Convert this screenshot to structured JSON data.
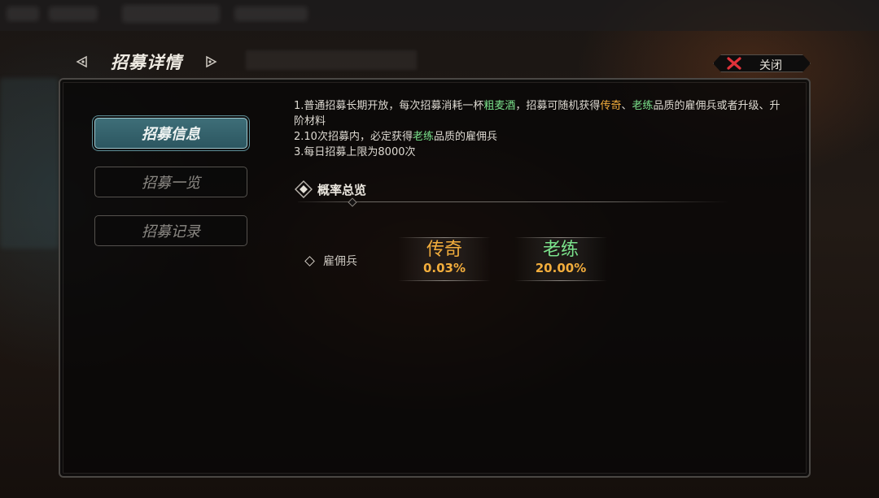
{
  "header": {
    "title": "招募详情",
    "close_label": "关闭"
  },
  "tabs": [
    {
      "label": "招募信息",
      "active": true
    },
    {
      "label": "招募一览",
      "active": false
    },
    {
      "label": "招募记录",
      "active": false
    }
  ],
  "description": {
    "line1_a": "1.普通招募长期开放，每次招募消耗一杯",
    "line1_item": "粗麦酒",
    "line1_b": "，招募可随机获得",
    "line1_rarity1": "传奇",
    "line1_sep": "、",
    "line1_rarity2": "老练",
    "line1_c": "品质的雇佣兵或者升级、升阶材料",
    "line2_a": "2.10次招募内，必定获得",
    "line2_rarity": "老练",
    "line2_b": "品质的雇佣兵",
    "line3": "3.每日招募上限为8000次"
  },
  "probability": {
    "section_title": "概率总览",
    "row_label": "雇佣兵",
    "rates": [
      {
        "name": "传奇",
        "value": "0.03%",
        "color": "#f2ad3c"
      },
      {
        "name": "老练",
        "value": "20.00%",
        "color": "#7be38c"
      }
    ]
  },
  "colors": {
    "legendary": "#f2ad3c",
    "veteran": "#7be38c",
    "active_tab": "#3e6e78",
    "close_x": "#e0323a"
  }
}
